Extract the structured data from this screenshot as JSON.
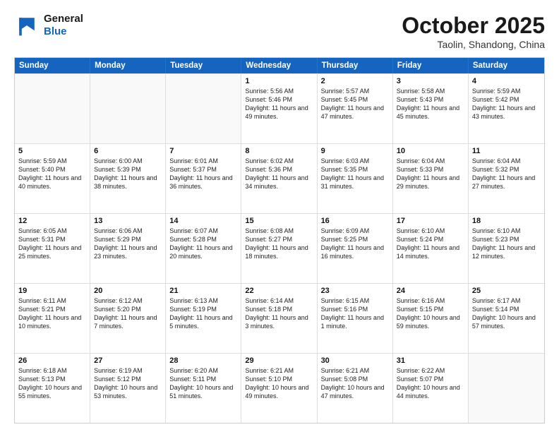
{
  "logo": {
    "line1": "General",
    "line2": "Blue"
  },
  "title": "October 2025",
  "location": "Taolin, Shandong, China",
  "weekdays": [
    "Sunday",
    "Monday",
    "Tuesday",
    "Wednesday",
    "Thursday",
    "Friday",
    "Saturday"
  ],
  "rows": [
    [
      {
        "day": "",
        "empty": true
      },
      {
        "day": "",
        "empty": true
      },
      {
        "day": "",
        "empty": true
      },
      {
        "day": "1",
        "info": "Sunrise: 5:56 AM\nSunset: 5:46 PM\nDaylight: 11 hours\nand 49 minutes."
      },
      {
        "day": "2",
        "info": "Sunrise: 5:57 AM\nSunset: 5:45 PM\nDaylight: 11 hours\nand 47 minutes."
      },
      {
        "day": "3",
        "info": "Sunrise: 5:58 AM\nSunset: 5:43 PM\nDaylight: 11 hours\nand 45 minutes."
      },
      {
        "day": "4",
        "info": "Sunrise: 5:59 AM\nSunset: 5:42 PM\nDaylight: 11 hours\nand 43 minutes."
      }
    ],
    [
      {
        "day": "5",
        "info": "Sunrise: 5:59 AM\nSunset: 5:40 PM\nDaylight: 11 hours\nand 40 minutes."
      },
      {
        "day": "6",
        "info": "Sunrise: 6:00 AM\nSunset: 5:39 PM\nDaylight: 11 hours\nand 38 minutes."
      },
      {
        "day": "7",
        "info": "Sunrise: 6:01 AM\nSunset: 5:37 PM\nDaylight: 11 hours\nand 36 minutes."
      },
      {
        "day": "8",
        "info": "Sunrise: 6:02 AM\nSunset: 5:36 PM\nDaylight: 11 hours\nand 34 minutes."
      },
      {
        "day": "9",
        "info": "Sunrise: 6:03 AM\nSunset: 5:35 PM\nDaylight: 11 hours\nand 31 minutes."
      },
      {
        "day": "10",
        "info": "Sunrise: 6:04 AM\nSunset: 5:33 PM\nDaylight: 11 hours\nand 29 minutes."
      },
      {
        "day": "11",
        "info": "Sunrise: 6:04 AM\nSunset: 5:32 PM\nDaylight: 11 hours\nand 27 minutes."
      }
    ],
    [
      {
        "day": "12",
        "info": "Sunrise: 6:05 AM\nSunset: 5:31 PM\nDaylight: 11 hours\nand 25 minutes."
      },
      {
        "day": "13",
        "info": "Sunrise: 6:06 AM\nSunset: 5:29 PM\nDaylight: 11 hours\nand 23 minutes."
      },
      {
        "day": "14",
        "info": "Sunrise: 6:07 AM\nSunset: 5:28 PM\nDaylight: 11 hours\nand 20 minutes."
      },
      {
        "day": "15",
        "info": "Sunrise: 6:08 AM\nSunset: 5:27 PM\nDaylight: 11 hours\nand 18 minutes."
      },
      {
        "day": "16",
        "info": "Sunrise: 6:09 AM\nSunset: 5:25 PM\nDaylight: 11 hours\nand 16 minutes."
      },
      {
        "day": "17",
        "info": "Sunrise: 6:10 AM\nSunset: 5:24 PM\nDaylight: 11 hours\nand 14 minutes."
      },
      {
        "day": "18",
        "info": "Sunrise: 6:10 AM\nSunset: 5:23 PM\nDaylight: 11 hours\nand 12 minutes."
      }
    ],
    [
      {
        "day": "19",
        "info": "Sunrise: 6:11 AM\nSunset: 5:21 PM\nDaylight: 11 hours\nand 10 minutes."
      },
      {
        "day": "20",
        "info": "Sunrise: 6:12 AM\nSunset: 5:20 PM\nDaylight: 11 hours\nand 7 minutes."
      },
      {
        "day": "21",
        "info": "Sunrise: 6:13 AM\nSunset: 5:19 PM\nDaylight: 11 hours\nand 5 minutes."
      },
      {
        "day": "22",
        "info": "Sunrise: 6:14 AM\nSunset: 5:18 PM\nDaylight: 11 hours\nand 3 minutes."
      },
      {
        "day": "23",
        "info": "Sunrise: 6:15 AM\nSunset: 5:16 PM\nDaylight: 11 hours\nand 1 minute."
      },
      {
        "day": "24",
        "info": "Sunrise: 6:16 AM\nSunset: 5:15 PM\nDaylight: 10 hours\nand 59 minutes."
      },
      {
        "day": "25",
        "info": "Sunrise: 6:17 AM\nSunset: 5:14 PM\nDaylight: 10 hours\nand 57 minutes."
      }
    ],
    [
      {
        "day": "26",
        "info": "Sunrise: 6:18 AM\nSunset: 5:13 PM\nDaylight: 10 hours\nand 55 minutes."
      },
      {
        "day": "27",
        "info": "Sunrise: 6:19 AM\nSunset: 5:12 PM\nDaylight: 10 hours\nand 53 minutes."
      },
      {
        "day": "28",
        "info": "Sunrise: 6:20 AM\nSunset: 5:11 PM\nDaylight: 10 hours\nand 51 minutes."
      },
      {
        "day": "29",
        "info": "Sunrise: 6:21 AM\nSunset: 5:10 PM\nDaylight: 10 hours\nand 49 minutes."
      },
      {
        "day": "30",
        "info": "Sunrise: 6:21 AM\nSunset: 5:08 PM\nDaylight: 10 hours\nand 47 minutes."
      },
      {
        "day": "31",
        "info": "Sunrise: 6:22 AM\nSunset: 5:07 PM\nDaylight: 10 hours\nand 44 minutes."
      },
      {
        "day": "",
        "empty": true
      }
    ]
  ]
}
